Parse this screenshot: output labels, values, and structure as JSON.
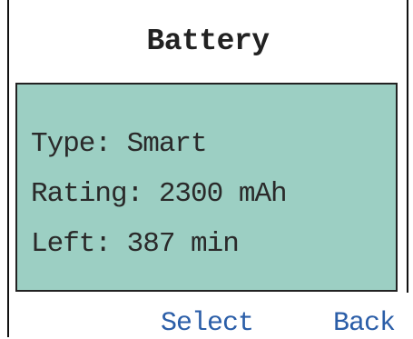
{
  "screen": {
    "title": "Battery"
  },
  "battery_info": {
    "type_line": "Type: Smart",
    "rating_line": "Rating: 2300 mAh",
    "left_line": "Left: 387 min"
  },
  "softkeys": {
    "select_label": "Select",
    "back_label": "Back"
  },
  "colors": {
    "panel_background": "#9ccfc3",
    "softkey_text": "#2b5ea8",
    "frame": "#111111"
  }
}
